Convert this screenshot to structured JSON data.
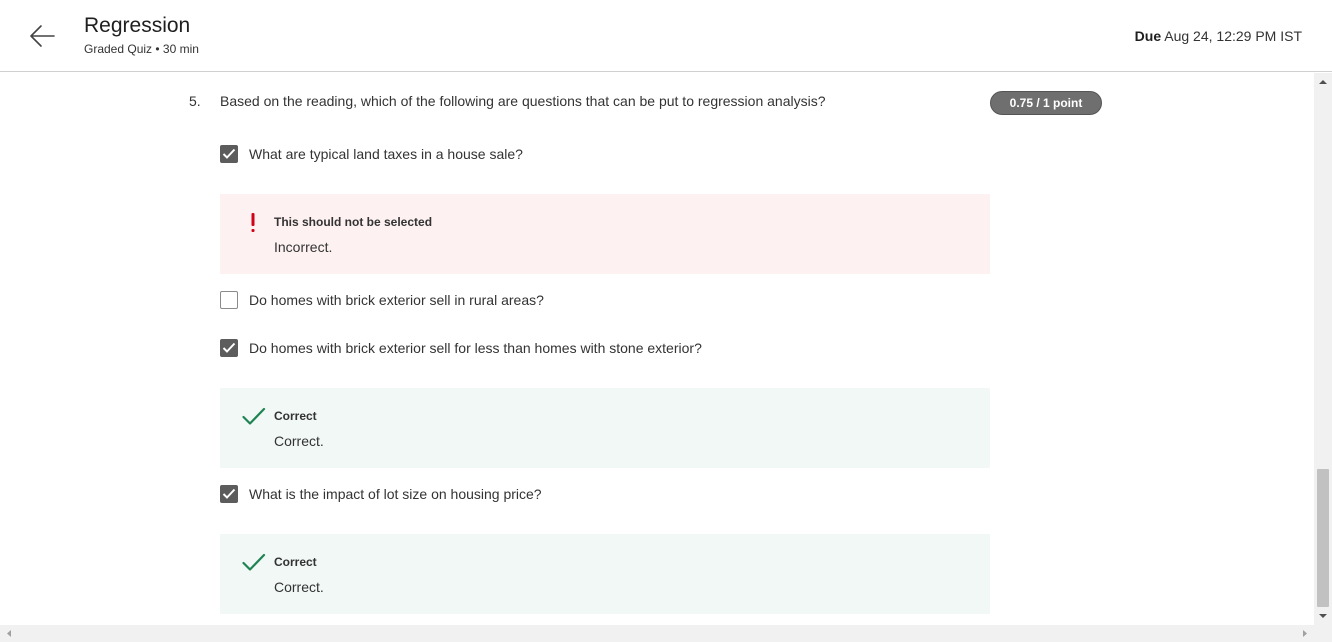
{
  "header": {
    "title": "Regression",
    "subtitle": "Graded Quiz • 30 min",
    "due_label": "Due",
    "due_value": "Aug 24, 12:29 PM IST"
  },
  "question": {
    "number": "5.",
    "text": "Based on the reading, which of the following are questions that can be put to regression analysis?",
    "score": "0.75 / 1 point",
    "options": [
      {
        "label": "What are typical land taxes in a house sale?",
        "checked": true
      },
      {
        "label": "Do homes with brick exterior sell in rural areas?",
        "checked": false
      },
      {
        "label": "Do homes with brick exterior sell for less than homes with stone exterior?",
        "checked": true
      },
      {
        "label": "What is the impact of lot size on housing price?",
        "checked": true
      }
    ],
    "feedback": [
      {
        "type": "incorrect",
        "title": "This should not be selected",
        "text": "Incorrect."
      },
      {
        "type": "correct",
        "title": "Correct",
        "text": "Correct."
      },
      {
        "type": "correct",
        "title": "Correct",
        "text": "Correct."
      }
    ]
  },
  "colors": {
    "checkbox_checked": "#5c5c5c",
    "incorrect_bg": "#fdf1f1",
    "incorrect_icon": "#d0021b",
    "correct_bg": "#f1f8f5",
    "correct_icon": "#1f8354",
    "score_badge": "#6f6f6f"
  }
}
